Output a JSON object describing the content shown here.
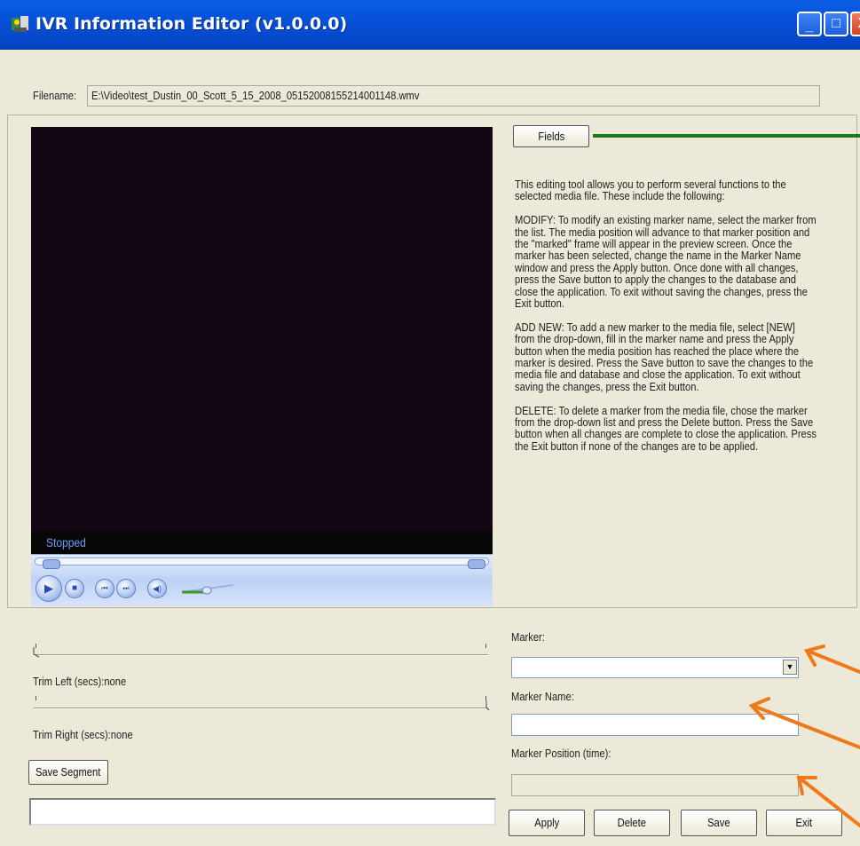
{
  "window": {
    "title": "IVR Information  Editor (v1.0.0.0)",
    "icon": "app-icon"
  },
  "filename": {
    "label": "Filename:",
    "value": "E:\\Video\\test_Dustin_00_Scott_5_15_2008_05152008155214001148.wmv"
  },
  "player": {
    "status": "Stopped"
  },
  "fields_button": "Fields",
  "help": [
    "This editing tool allows you to perform several functions to the selected media file. These include the following:",
    "MODIFY: To modify an existing marker name, select the marker from the list. The media position will advance to that marker position and the \"marked\" frame will appear in the preview screen. Once the marker has been selected, change the name in the Marker Name window and press the Apply button. Once done with all changes, press the Save button to apply the changes to the database and close the application. To exit without saving the changes, press the Exit button.",
    "ADD NEW: To add a new marker to the media file, select [NEW] from the drop-down, fill in the marker name and press the Apply button when the media position has reached the place where the marker is desired. Press the Save button to save the changes to the media file and database and close the application. To exit without saving the changes, press the Exit button.",
    "DELETE: To delete a marker from the media file, chose the marker from the drop-down list and press the Delete button. Press the Save button when all changes are complete to close the application. Press the Exit button if none of the changes are to be applied."
  ],
  "trim": {
    "left_label": "Trim Left (secs):none",
    "right_label": "Trim Right (secs):none",
    "save_segment": "Save Segment",
    "segment_value": ""
  },
  "marker": {
    "marker_label": "Marker:",
    "marker_value": "",
    "name_label": "Marker Name:",
    "name_value": "",
    "position_label": "Marker Position (time):",
    "position_value": ""
  },
  "buttons": {
    "apply": "Apply",
    "delete": "Delete",
    "save": "Save",
    "exit": "Exit"
  },
  "colors": {
    "titlebar": "#0551d8",
    "window_bg": "#ece9d8",
    "green_arrow": "#1a7a1a",
    "orange_arrow": "#f07a1a"
  }
}
